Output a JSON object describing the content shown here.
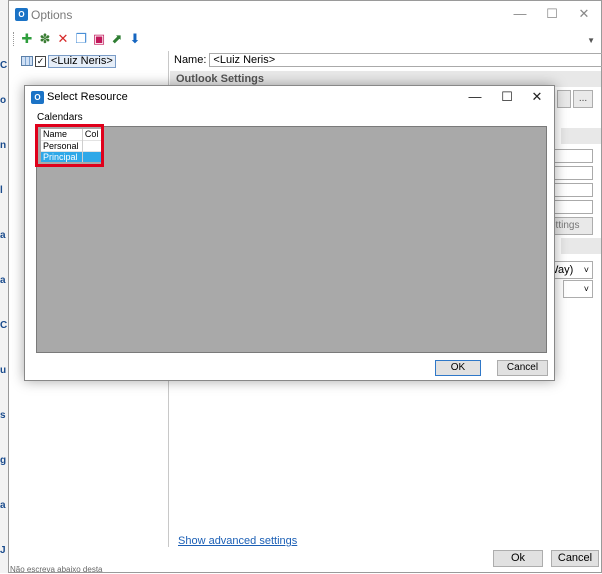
{
  "options_window": {
    "title": "Options",
    "minimize_glyph": "—",
    "maximize_glyph": "☐",
    "close_glyph": "✕",
    "toolbar_icons": [
      "add-icon",
      "add-shared-icon",
      "delete-icon",
      "copy-icon",
      "remove-icon",
      "export-icon",
      "import-icon"
    ],
    "tree": {
      "label": "<Luiz Neris>",
      "checked": "✓"
    },
    "name_label": "Name:",
    "name_value": "<Luiz Neris>",
    "section_outlook": "Outlook Settings",
    "browse_glyph": "...",
    "partial_settings_button": "ettings",
    "combo_partial": "Way)",
    "chevron_glyph": "˅",
    "advanced_link": "Show advanced settings",
    "ok_label": "Ok",
    "cancel_label": "Cancel"
  },
  "dialog": {
    "title": "Select Resource",
    "minimize_glyph": "—",
    "maximize_glyph": "☐",
    "close_glyph": "✕",
    "tab_label": "Calendars",
    "columns": [
      "Name",
      "Col"
    ],
    "rows": [
      {
        "name": "Personal",
        "col": "",
        "selected": false
      },
      {
        "name": "Principal",
        "col": "",
        "selected": true
      }
    ],
    "ok_label": "OK",
    "cancel_label": "Cancel"
  },
  "background": {
    "bottom_text": "Não escreva abaixo desta"
  },
  "colors": {
    "selection": "#2fa8e8",
    "highlight_border": "#e0001b",
    "link": "#1b5fb5",
    "dialog_area": "#a9a9a9"
  }
}
